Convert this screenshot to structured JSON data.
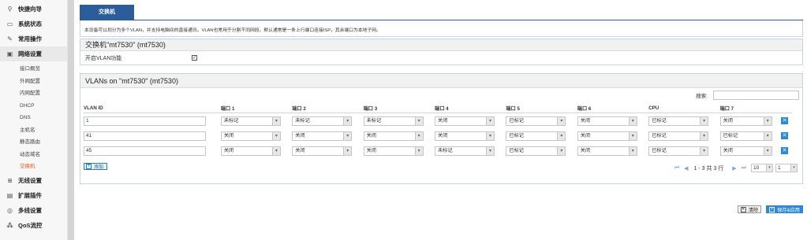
{
  "sidebar": {
    "groups": [
      {
        "label": "快捷向导",
        "icon": "wand-icon"
      },
      {
        "label": "系统状态",
        "icon": "monitor-icon"
      },
      {
        "label": "常用操作",
        "icon": "wrench-icon"
      },
      {
        "label": "网络设置",
        "icon": "network-icon"
      }
    ],
    "sub_items": [
      "接口概览",
      "外网配置",
      "内网配置",
      "DHCP",
      "DNS",
      "主机名",
      "静态路由",
      "动态域名",
      "交换机"
    ],
    "groups_after": [
      {
        "label": "无线设置",
        "icon": "wifi-icon"
      },
      {
        "label": "扩展插件",
        "icon": "puzzle-icon"
      },
      {
        "label": "多线设置",
        "icon": "multiline-icon"
      },
      {
        "label": "QoS流控",
        "icon": "qos-icon"
      }
    ]
  },
  "tab": {
    "label": "交换机"
  },
  "description": "本设备可以划分为多个VLAN，并支持电脑间的直接通讯。VLAN也常用于分割不同网段。默认通常是一条上行端口连接ISP，其余端口为本地子网。",
  "switch_section": {
    "title": "交换机\"mt7530\" (mt7530)",
    "enable_vlan_label": "开启VLAN功能",
    "enable_vlan_checked": true,
    "check_glyph": "✓"
  },
  "vlan_section": {
    "title": "VLANs on \"mt7530\" (mt7530)",
    "search_label": "搜索:",
    "search_value": "",
    "columns": [
      "VLAN ID",
      "端口 1",
      "端口 2",
      "端口 3",
      "端口 4",
      "端口 5",
      "端口 6",
      "CPU",
      "端口 7"
    ],
    "rows": [
      {
        "id": "1",
        "ports": [
          "未标记",
          "未标记",
          "未标记",
          "关闭",
          "已标记",
          "关闭",
          "已标记",
          "关闭"
        ]
      },
      {
        "id": "41",
        "ports": [
          "关闭",
          "关闭",
          "关闭",
          "关闭",
          "已标记",
          "关闭",
          "已标记",
          "已标记"
        ]
      },
      {
        "id": "45",
        "ports": [
          "关闭",
          "关闭",
          "关闭",
          "未标记",
          "已标记",
          "关闭",
          "已标记",
          "关闭"
        ]
      }
    ],
    "delete_glyph": "✕",
    "add_label": "添加",
    "add_glyph": "+",
    "pagination": {
      "info": "1 - 3 共 3 行",
      "first": "⏮",
      "prev": "◀",
      "next": "▶",
      "last": "⏭",
      "page_size": "10",
      "page": "1"
    }
  },
  "footer": {
    "clear_label": "清除",
    "save_label": "保存&应用"
  },
  "select_arrow": "▾",
  "colors": {
    "accent": "#2a5d99",
    "active_nav": "#e8591d",
    "button_blue": "#2b8ad8"
  }
}
